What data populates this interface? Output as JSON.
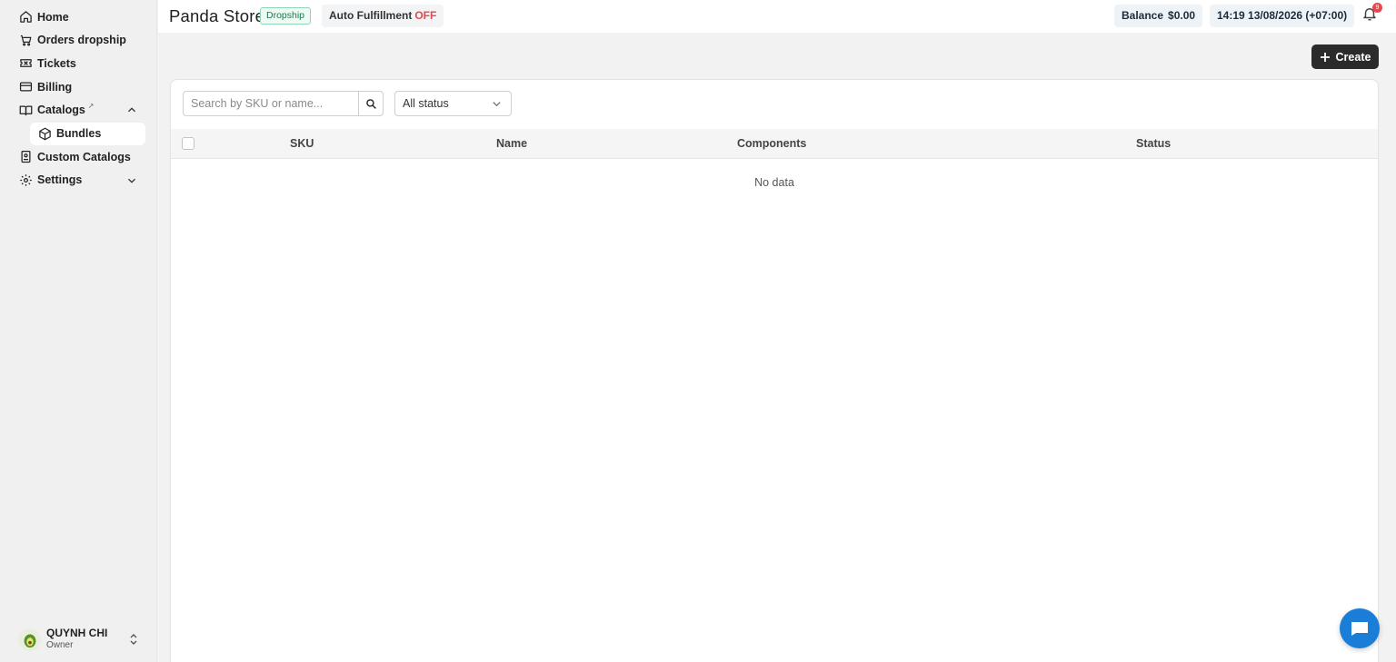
{
  "sidebar": {
    "items": [
      {
        "label": "Home",
        "icon": "home-icon"
      },
      {
        "label": "Orders dropship",
        "icon": "cart-icon"
      },
      {
        "label": "Tickets",
        "icon": "ticket-icon"
      },
      {
        "label": "Billing",
        "icon": "credit-card-icon"
      },
      {
        "label": "Catalogs",
        "icon": "book-icon",
        "sup": "↗"
      },
      {
        "label": "Bundles",
        "icon": "box-icon",
        "active": true
      },
      {
        "label": "Custom Catalogs",
        "icon": "catalog-icon"
      },
      {
        "label": "Settings",
        "icon": "gear-icon"
      }
    ]
  },
  "user": {
    "name": "QUYNH CHI",
    "role": "Owner"
  },
  "header": {
    "store": "Panda Store",
    "tag": "Dropship",
    "auto_fulfillment_label": "Auto Fulfillment",
    "auto_fulfillment_state": "OFF",
    "balance_label": "Balance",
    "balance_value": "$0.00",
    "datetime": "14:19 13/08/2026 (+07:00)",
    "notification_count": "9"
  },
  "toolbar": {
    "create_label": "Create"
  },
  "filters": {
    "search_placeholder": "Search by SKU or name...",
    "status_selected": "All status"
  },
  "table": {
    "columns": [
      "SKU",
      "Name",
      "Components",
      "Status"
    ],
    "empty_text": "No data"
  },
  "colors": {
    "accent": "#1a7ed8",
    "off": "#e5484d",
    "dark_button": "#2b2b2b"
  }
}
